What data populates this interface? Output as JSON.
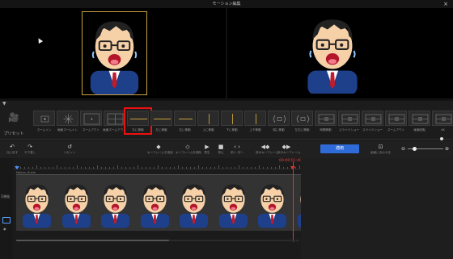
{
  "window": {
    "title": "モーション編集",
    "close_glyph": "×"
  },
  "preview": {
    "left_character": "character-illustration-icon",
    "right_character": "character-illustration-icon"
  },
  "presets": {
    "toggle_glyph": "▼",
    "section_label": "プリセット",
    "camera_icon": "camera-icon",
    "items": [
      {
        "label": "ズームイン",
        "glyph": "zoom-in"
      },
      {
        "label": "画面ズームイン",
        "glyph": "burst"
      },
      {
        "label": "ズームアウト",
        "glyph": "dot-box"
      },
      {
        "label": "画面ズームアウト",
        "glyph": "split"
      },
      {
        "label": "左に移動",
        "glyph": "hline"
      },
      {
        "label": "左に移動",
        "glyph": "hline"
      },
      {
        "label": "右に移動",
        "glyph": "hline-short"
      },
      {
        "label": "上に移動",
        "glyph": "vline"
      },
      {
        "label": "下に移動",
        "glyph": "vline"
      },
      {
        "label": "上下移動",
        "glyph": "vline"
      },
      {
        "label": "縦に移動",
        "glyph": "bracket"
      },
      {
        "label": "左右に移動",
        "glyph": "bracket"
      },
      {
        "label": "時間移動",
        "glyph": "box-split"
      },
      {
        "label": "スライドショー",
        "glyph": "box-split"
      },
      {
        "label": "スライドショー",
        "glyph": "box-split"
      },
      {
        "label": "ズームアウト",
        "glyph": "box-split"
      },
      {
        "label": "画面回転",
        "glyph": "box-split"
      },
      {
        "label": "4K",
        "glyph": "box-split"
      }
    ],
    "selected_index": 4
  },
  "toolbar": {
    "tools": [
      {
        "icon": "↶",
        "label": "元に戻す",
        "name": "undo"
      },
      {
        "icon": "↷",
        "label": "やり直し",
        "name": "redo"
      },
      {
        "icon": "↺",
        "label": "リセット",
        "name": "reset"
      },
      {
        "icon": "◆",
        "label": "キーフレームを追加",
        "name": "add-keyframe"
      },
      {
        "icon": "◇",
        "label": "キーフレームを削除",
        "name": "delete-keyframe"
      },
      {
        "icon": "▶",
        "label": "再生",
        "name": "play"
      },
      {
        "icon": "■",
        "label": "停止",
        "name": "stop"
      },
      {
        "icon": "‹ ›",
        "label": "前へ 次へ",
        "name": "prev-next"
      },
      {
        "icon": "◀◆",
        "label": "前のキーフレーム",
        "name": "prev-keyframe"
      },
      {
        "icon": "◆▶",
        "label": "次のキーフレーム",
        "name": "next-keyframe"
      }
    ],
    "apply_label": "適用",
    "fit_icon": "⊡",
    "fit_label": "画面に合わせる",
    "zoom_minus": "⊖",
    "zoom_plus": "⊕",
    "zoom_level": 0.15
  },
  "timeline": {
    "timecode": "00:00:01:40",
    "visibility_label": "可視化",
    "track_label": "Motion_Guide",
    "clip_count": 8,
    "accent_color": "#e03434",
    "playhead_color": "#4d8fff",
    "scroll_fraction": 0.54
  }
}
